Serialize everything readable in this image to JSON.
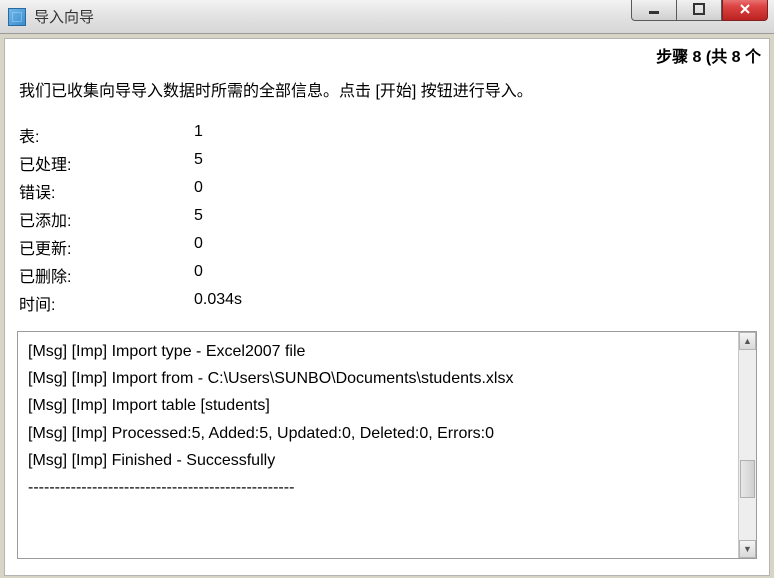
{
  "window": {
    "title": "导入向导"
  },
  "step_label": "步骤 8 (共 8 个",
  "instruction": "我们已收集向导导入数据时所需的全部信息。点击 [开始] 按钮进行导入。",
  "stats": {
    "rows": [
      {
        "label": "表:",
        "value": "1"
      },
      {
        "label": "已处理:",
        "value": "5"
      },
      {
        "label": "错误:",
        "value": "0"
      },
      {
        "label": "已添加:",
        "value": "5"
      },
      {
        "label": "已更新:",
        "value": "0"
      },
      {
        "label": "已删除:",
        "value": "0"
      },
      {
        "label": "时间:",
        "value": "0.034s"
      }
    ]
  },
  "log": {
    "lines": [
      "[Msg] [Imp] Import type - Excel2007 file",
      "[Msg] [Imp] Import from - C:\\Users\\SUNBO\\Documents\\students.xlsx",
      "[Msg] [Imp] Import table [students]",
      "[Msg] [Imp] Processed:5, Added:5, Updated:0, Deleted:0, Errors:0",
      "[Msg] [Imp] Finished - Successfully",
      "--------------------------------------------------"
    ]
  }
}
